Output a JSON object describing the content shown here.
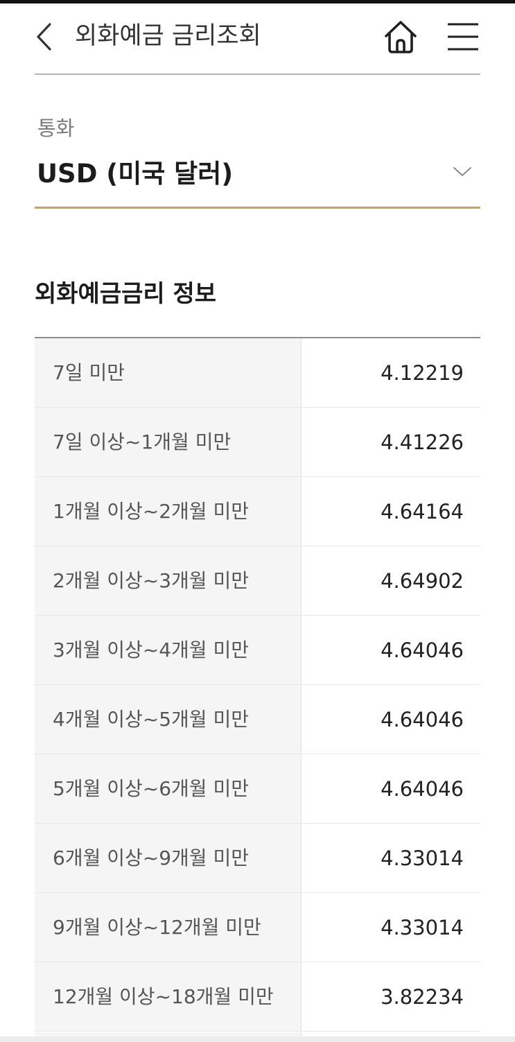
{
  "header": {
    "title": "외화예금 금리조회",
    "back_icon": "chevron-left-icon",
    "home_icon": "home-icon",
    "menu_icon": "hamburger-menu-icon"
  },
  "currency": {
    "label": "통화",
    "selected": "USD (미국 달러)",
    "dropdown_icon": "chevron-down-icon",
    "accent_color": "#b9a57c"
  },
  "rates_section": {
    "title": "외화예금금리 정보",
    "rows": [
      {
        "period": "7일 미만",
        "rate": "4.12219"
      },
      {
        "period": "7일 이상~1개월 미만",
        "rate": "4.41226"
      },
      {
        "period": "1개월 이상~2개월 미만",
        "rate": "4.64164"
      },
      {
        "period": "2개월 이상~3개월 미만",
        "rate": "4.64902"
      },
      {
        "period": "3개월 이상~4개월 미만",
        "rate": "4.64046"
      },
      {
        "period": "4개월 이상~5개월 미만",
        "rate": "4.64046"
      },
      {
        "period": "5개월 이상~6개월 미만",
        "rate": "4.64046"
      },
      {
        "period": "6개월 이상~9개월 미만",
        "rate": "4.33014"
      },
      {
        "period": "9개월 이상~12개월 미만",
        "rate": "4.33014"
      },
      {
        "period": "12개월 이상~18개월 미만",
        "rate": "3.82234"
      }
    ]
  }
}
